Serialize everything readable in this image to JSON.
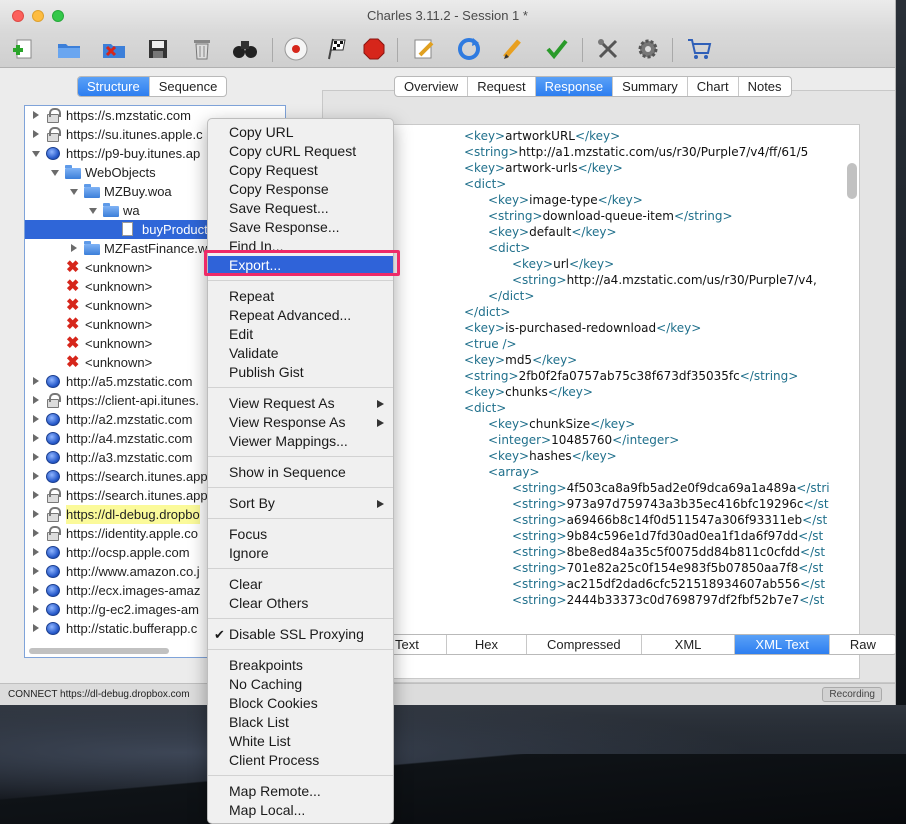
{
  "window": {
    "title": "Charles 3.11.2 - Session 1 *"
  },
  "toolbar": {
    "buttons": [
      "new-session-icon",
      "open-session-icon",
      "close-session-icon",
      "save-icon",
      "trash-icon",
      "binoculars-icon",
      "record-icon",
      "throttle-flag-icon",
      "breakpoint-stop-icon",
      "edit-request-icon",
      "repeat-icon",
      "pencil-icon",
      "validate-check-icon",
      "tools-icon",
      "settings-gear-icon",
      "shopping-cart-icon"
    ]
  },
  "view_tabs": [
    "Structure",
    "Sequence"
  ],
  "view_tabs_active": "Structure",
  "detail_tabs": [
    "Overview",
    "Request",
    "Response",
    "Summary",
    "Chart",
    "Notes"
  ],
  "detail_tabs_active": "Response",
  "tree": [
    {
      "label": "https://s.mzstatic.com",
      "icon": "lock",
      "indent": 0,
      "disclosure": "right"
    },
    {
      "label": "https://su.itunes.apple.c",
      "icon": "lock",
      "indent": 0,
      "disclosure": "right"
    },
    {
      "label": "https://p9-buy.itunes.ap",
      "icon": "globe",
      "indent": 0,
      "disclosure": "down"
    },
    {
      "label": "WebObjects",
      "icon": "folder",
      "indent": 1,
      "disclosure": "down"
    },
    {
      "label": "MZBuy.woa",
      "icon": "folder",
      "indent": 2,
      "disclosure": "down"
    },
    {
      "label": "wa",
      "icon": "folder",
      "indent": 3,
      "disclosure": "down"
    },
    {
      "label": "buyProduct",
      "icon": "doc",
      "indent": 4,
      "disclosure": "none",
      "selected": true
    },
    {
      "label": "MZFastFinance.woa",
      "icon": "folder",
      "indent": 2,
      "disclosure": "right"
    },
    {
      "label": "<unknown>",
      "icon": "x",
      "indent": 1,
      "disclosure": "none"
    },
    {
      "label": "<unknown>",
      "icon": "x",
      "indent": 1,
      "disclosure": "none"
    },
    {
      "label": "<unknown>",
      "icon": "x",
      "indent": 1,
      "disclosure": "none"
    },
    {
      "label": "<unknown>",
      "icon": "x",
      "indent": 1,
      "disclosure": "none"
    },
    {
      "label": "<unknown>",
      "icon": "x",
      "indent": 1,
      "disclosure": "none"
    },
    {
      "label": "<unknown>",
      "icon": "x",
      "indent": 1,
      "disclosure": "none"
    },
    {
      "label": "http://a5.mzstatic.com",
      "icon": "globe",
      "indent": 0,
      "disclosure": "right"
    },
    {
      "label": "https://client-api.itunes.",
      "icon": "lock",
      "indent": 0,
      "disclosure": "right"
    },
    {
      "label": "http://a2.mzstatic.com",
      "icon": "globe",
      "indent": 0,
      "disclosure": "right"
    },
    {
      "label": "http://a4.mzstatic.com",
      "icon": "globe",
      "indent": 0,
      "disclosure": "right"
    },
    {
      "label": "http://a3.mzstatic.com",
      "icon": "globe",
      "indent": 0,
      "disclosure": "right"
    },
    {
      "label": "https://search.itunes.app",
      "icon": "globe",
      "indent": 0,
      "disclosure": "right"
    },
    {
      "label": "https://search.itunes.app",
      "icon": "lock",
      "indent": 0,
      "disclosure": "right"
    },
    {
      "label": "https://dl-debug.dropbo",
      "icon": "lock",
      "indent": 0,
      "disclosure": "right",
      "highlight": true
    },
    {
      "label": "https://identity.apple.co",
      "icon": "lock",
      "indent": 0,
      "disclosure": "right"
    },
    {
      "label": "http://ocsp.apple.com",
      "icon": "globe",
      "indent": 0,
      "disclosure": "right"
    },
    {
      "label": "http://www.amazon.co.j",
      "icon": "globe",
      "indent": 0,
      "disclosure": "right"
    },
    {
      "label": "http://ecx.images-amaz",
      "icon": "globe",
      "indent": 0,
      "disclosure": "right"
    },
    {
      "label": "http://g-ec2.images-am",
      "icon": "globe",
      "indent": 0,
      "disclosure": "right"
    },
    {
      "label": "http://static.bufferapp.c",
      "icon": "globe",
      "indent": 0,
      "disclosure": "right"
    }
  ],
  "xml_lines": [
    {
      "indent": 0,
      "parts": [
        [
          "t",
          "<key>"
        ],
        [
          "v",
          "artworkURL"
        ],
        [
          "t",
          "</key>"
        ]
      ]
    },
    {
      "indent": 0,
      "parts": [
        [
          "t",
          "<string>"
        ],
        [
          "v",
          "http://a1.mzstatic.com/us/r30/Purple7/v4/ff/61/5"
        ]
      ]
    },
    {
      "indent": 0,
      "parts": [
        [
          "t",
          "<key>"
        ],
        [
          "v",
          "artwork-urls"
        ],
        [
          "t",
          "</key>"
        ]
      ]
    },
    {
      "indent": 0,
      "parts": [
        [
          "t",
          "<dict>"
        ]
      ]
    },
    {
      "indent": 1,
      "parts": [
        [
          "t",
          "<key>"
        ],
        [
          "v",
          "image-type"
        ],
        [
          "t",
          "</key>"
        ]
      ]
    },
    {
      "indent": 1,
      "parts": [
        [
          "t",
          "<string>"
        ],
        [
          "v",
          "download-queue-item"
        ],
        [
          "t",
          "</string>"
        ]
      ]
    },
    {
      "indent": 1,
      "parts": [
        [
          "t",
          "<key>"
        ],
        [
          "v",
          "default"
        ],
        [
          "t",
          "</key>"
        ]
      ]
    },
    {
      "indent": 1,
      "parts": [
        [
          "t",
          "<dict>"
        ]
      ]
    },
    {
      "indent": 2,
      "parts": [
        [
          "t",
          "<key>"
        ],
        [
          "v",
          "url"
        ],
        [
          "t",
          "</key>"
        ]
      ]
    },
    {
      "indent": 2,
      "parts": [
        [
          "t",
          "<string>"
        ],
        [
          "v",
          "http://a4.mzstatic.com/us/r30/Purple7/v4,"
        ]
      ]
    },
    {
      "indent": 1,
      "parts": [
        [
          "t",
          "</dict>"
        ]
      ]
    },
    {
      "indent": 0,
      "parts": [
        [
          "t",
          "</dict>"
        ]
      ]
    },
    {
      "indent": 0,
      "parts": [
        [
          "t",
          "<key>"
        ],
        [
          "v",
          "is-purchased-redownload"
        ],
        [
          "t",
          "</key>"
        ]
      ]
    },
    {
      "indent": 0,
      "parts": [
        [
          "t",
          "<true />"
        ]
      ]
    },
    {
      "indent": 0,
      "parts": [
        [
          "t",
          "<key>"
        ],
        [
          "v",
          "md5"
        ],
        [
          "t",
          "</key>"
        ]
      ]
    },
    {
      "indent": 0,
      "parts": [
        [
          "t",
          "<string>"
        ],
        [
          "v",
          "2fb0f2fa0757ab75c38f673df35035fc"
        ],
        [
          "t",
          "</string>"
        ]
      ]
    },
    {
      "indent": 0,
      "parts": [
        [
          "t",
          "<key>"
        ],
        [
          "v",
          "chunks"
        ],
        [
          "t",
          "</key>"
        ]
      ]
    },
    {
      "indent": 0,
      "parts": [
        [
          "t",
          "<dict>"
        ]
      ]
    },
    {
      "indent": 1,
      "parts": [
        [
          "t",
          "<key>"
        ],
        [
          "v",
          "chunkSize"
        ],
        [
          "t",
          "</key>"
        ]
      ]
    },
    {
      "indent": 1,
      "parts": [
        [
          "t",
          "<integer>"
        ],
        [
          "v",
          "10485760"
        ],
        [
          "t",
          "</integer>"
        ]
      ]
    },
    {
      "indent": 1,
      "parts": [
        [
          "t",
          "<key>"
        ],
        [
          "v",
          "hashes"
        ],
        [
          "t",
          "</key>"
        ]
      ]
    },
    {
      "indent": 1,
      "parts": [
        [
          "t",
          "<array>"
        ]
      ]
    },
    {
      "indent": 2,
      "parts": [
        [
          "t",
          "<string>"
        ],
        [
          "v",
          "4f503ca8a9fb5ad2e0f9dca69a1a489a"
        ],
        [
          "t",
          "</stri"
        ]
      ]
    },
    {
      "indent": 2,
      "parts": [
        [
          "t",
          "<string>"
        ],
        [
          "v",
          "973a97d759743a3b35ec416bfc19296c"
        ],
        [
          "t",
          "</st"
        ]
      ]
    },
    {
      "indent": 2,
      "parts": [
        [
          "t",
          "<string>"
        ],
        [
          "v",
          "a69466b8c14f0d511547a306f93311eb"
        ],
        [
          "t",
          "</st"
        ]
      ]
    },
    {
      "indent": 2,
      "parts": [
        [
          "t",
          "<string>"
        ],
        [
          "v",
          "9b84c596e1d7fd30ad0ea1f1da6f97dd"
        ],
        [
          "t",
          "</st"
        ]
      ]
    },
    {
      "indent": 2,
      "parts": [
        [
          "t",
          "<string>"
        ],
        [
          "v",
          "8be8ed84a35c5f0075dd84b811c0cfdd"
        ],
        [
          "t",
          "</st"
        ]
      ]
    },
    {
      "indent": 2,
      "parts": [
        [
          "t",
          "<string>"
        ],
        [
          "v",
          "701e82a25c0f154e983f5b07850aa7f8"
        ],
        [
          "t",
          "</st"
        ]
      ]
    },
    {
      "indent": 2,
      "parts": [
        [
          "t",
          "<string>"
        ],
        [
          "v",
          "ac215df2dad6cfc521518934607ab556"
        ],
        [
          "t",
          "</st"
        ]
      ]
    },
    {
      "indent": 2,
      "parts": [
        [
          "t",
          "<string>"
        ],
        [
          "v",
          "2444b33373c0d7698797df2fbf52b7e7"
        ],
        [
          "t",
          "</st"
        ]
      ]
    }
  ],
  "bottom_tabs": [
    "Text",
    "Hex",
    "Compressed",
    "XML",
    "XML Text",
    "Raw"
  ],
  "bottom_tabs_active": "XML Text",
  "status": {
    "text": "CONNECT https://dl-debug.dropbox.com",
    "recording": "Recording"
  },
  "context_menu": {
    "groups": [
      [
        {
          "label": "Copy URL"
        },
        {
          "label": "Copy cURL Request"
        },
        {
          "label": "Copy Request"
        },
        {
          "label": "Copy Response"
        },
        {
          "label": "Save Request..."
        },
        {
          "label": "Save Response..."
        },
        {
          "label": "Find In..."
        },
        {
          "label": "Export...",
          "active": true
        }
      ],
      [
        {
          "label": "Repeat"
        },
        {
          "label": "Repeat Advanced..."
        },
        {
          "label": "Edit"
        },
        {
          "label": "Validate"
        },
        {
          "label": "Publish Gist"
        }
      ],
      [
        {
          "label": "View Request As",
          "submenu": true
        },
        {
          "label": "View Response As",
          "submenu": true
        },
        {
          "label": "Viewer Mappings..."
        }
      ],
      [
        {
          "label": "Show in Sequence"
        }
      ],
      [
        {
          "label": "Sort By",
          "submenu": true
        }
      ],
      [
        {
          "label": "Focus"
        },
        {
          "label": "Ignore"
        }
      ],
      [
        {
          "label": "Clear"
        },
        {
          "label": "Clear Others"
        }
      ],
      [
        {
          "label": "Disable SSL Proxying",
          "checked": true,
          "check_mark": "✔"
        }
      ],
      [
        {
          "label": "Breakpoints"
        },
        {
          "label": "No Caching"
        },
        {
          "label": "Block Cookies"
        },
        {
          "label": "Black List"
        },
        {
          "label": "White List"
        },
        {
          "label": "Client Process"
        }
      ],
      [
        {
          "label": "Map Remote..."
        },
        {
          "label": "Map Local..."
        }
      ]
    ]
  },
  "colors": {
    "selection": "#2f66d8",
    "menu_highlight": "#2f63d9",
    "annotation_box": "#ee2a68",
    "xml_tag": "#1f6f8b",
    "tab_active": "#2d7ef0",
    "highlight_row": "#fbfa9a"
  }
}
